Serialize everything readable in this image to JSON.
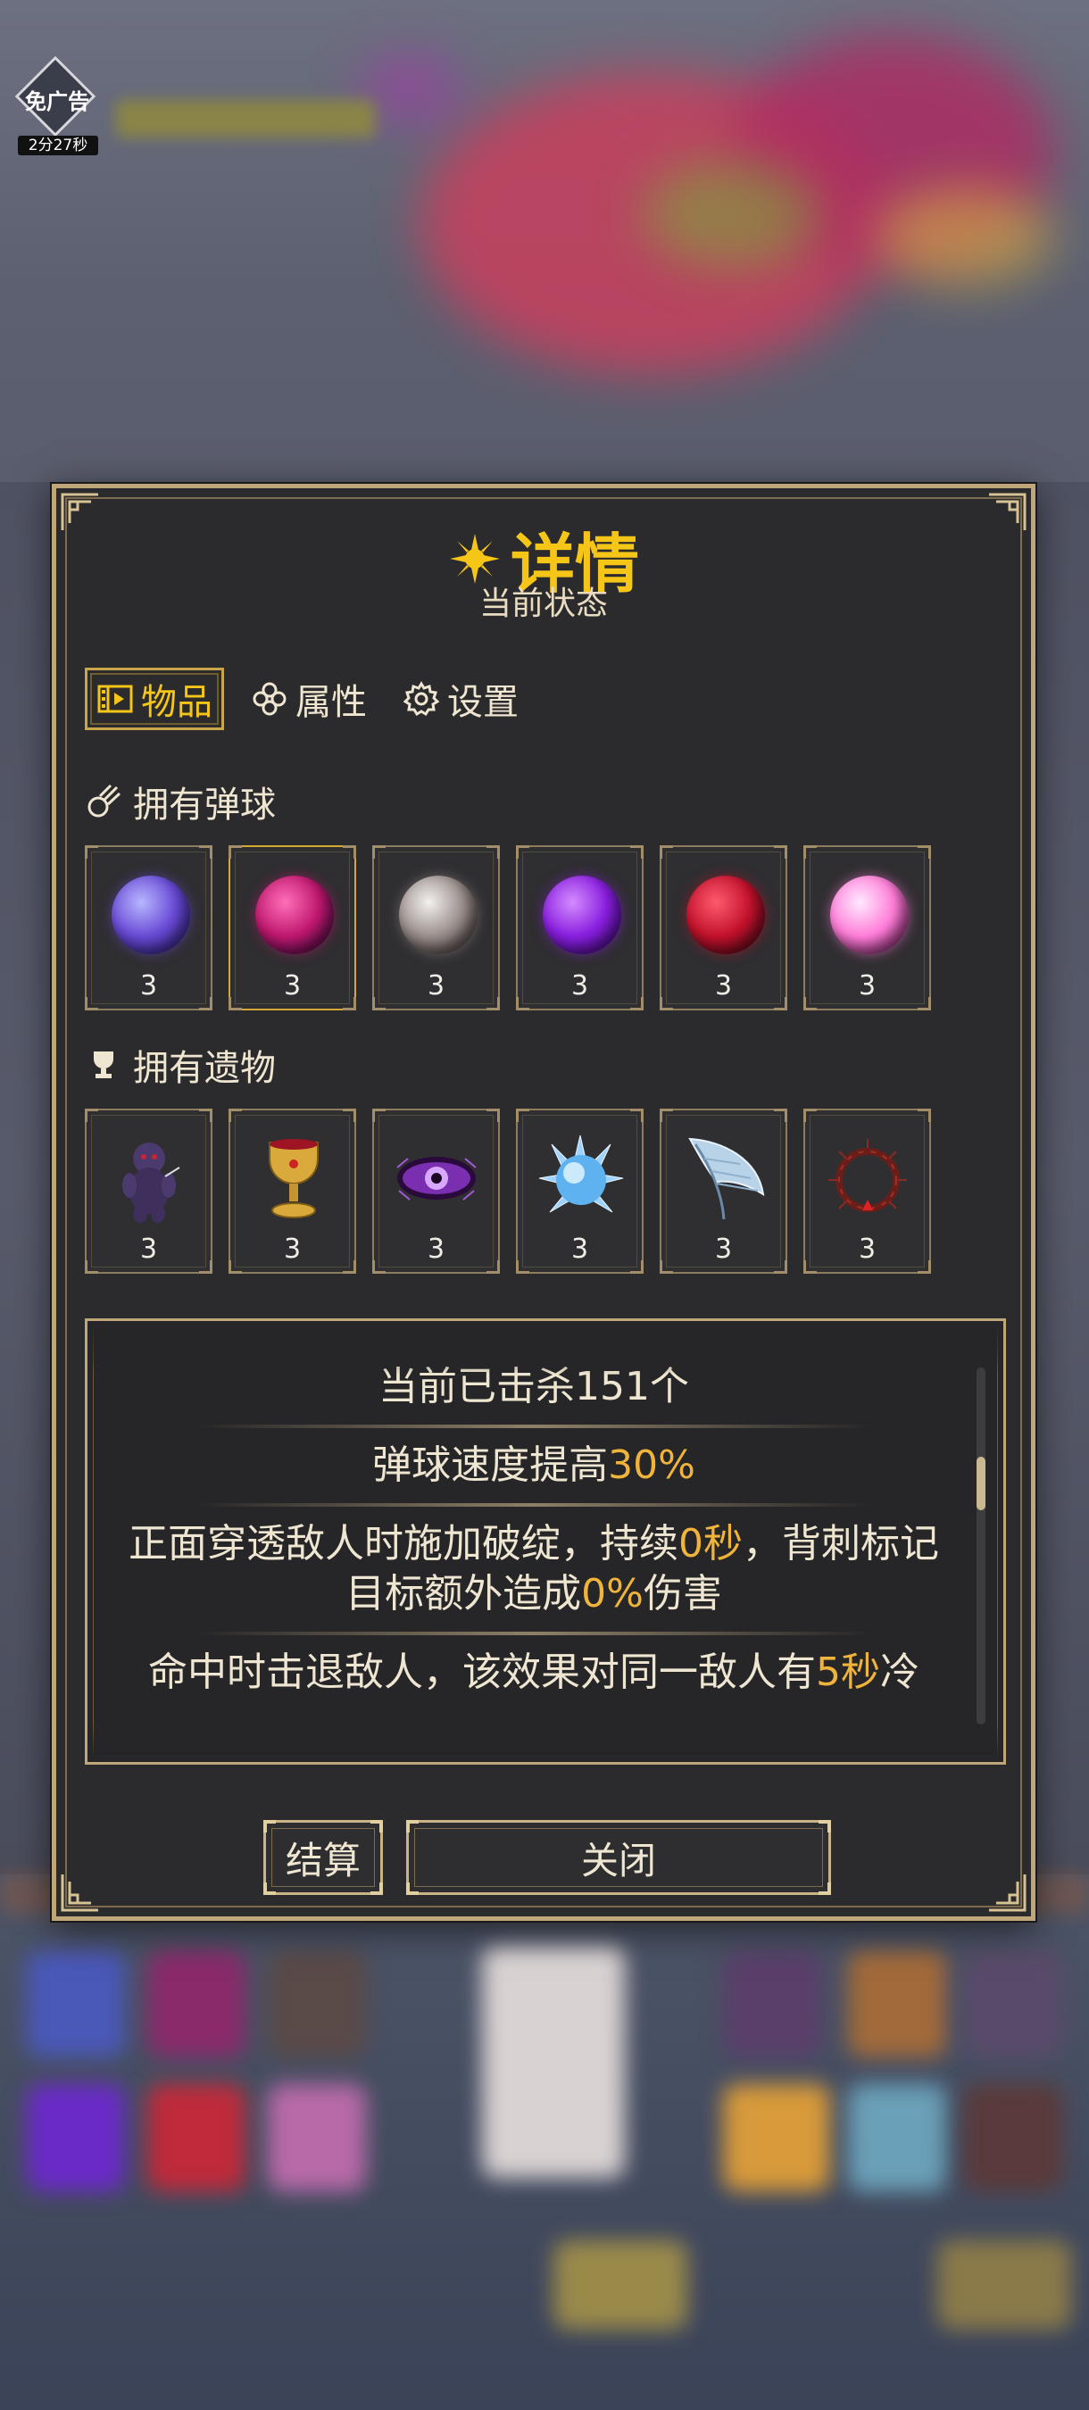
{
  "ad": {
    "label": "免广告",
    "timer": "2分27秒"
  },
  "panel": {
    "title": "详情",
    "subtitle": "当前状态"
  },
  "tabs": [
    {
      "label": "物品",
      "icon": "film-icon",
      "active": true
    },
    {
      "label": "属性",
      "icon": "clover-icon",
      "active": false
    },
    {
      "label": "设置",
      "icon": "gear-icon",
      "active": false
    }
  ],
  "balls": {
    "header": "拥有弹球",
    "items": [
      {
        "name": "blue-purple-orb",
        "count": "3",
        "colors": [
          "#b7b6ff",
          "#6a4bd6",
          "#2c1a7a"
        ]
      },
      {
        "name": "magenta-orb",
        "count": "3",
        "colors": [
          "#ff6fb8",
          "#c0186e",
          "#3b0a48"
        ]
      },
      {
        "name": "silver-orb",
        "count": "3",
        "colors": [
          "#f3f0ee",
          "#9a8f8c",
          "#3a2f30"
        ]
      },
      {
        "name": "violet-orb",
        "count": "3",
        "colors": [
          "#d48cff",
          "#8a1fe0",
          "#3a0875"
        ]
      },
      {
        "name": "crimson-orb",
        "count": "3",
        "colors": [
          "#ff5a6e",
          "#c3122c",
          "#4a0616"
        ]
      },
      {
        "name": "plasma-orb",
        "count": "3",
        "colors": [
          "#ffe9ff",
          "#ff7ed9",
          "#6a1155"
        ]
      }
    ]
  },
  "relics": {
    "header": "拥有遗物",
    "items": [
      {
        "name": "voodoo-doll",
        "count": "3"
      },
      {
        "name": "golden-chalice",
        "count": "3"
      },
      {
        "name": "purple-eye",
        "count": "3"
      },
      {
        "name": "ice-orb",
        "count": "3"
      },
      {
        "name": "feather-wing",
        "count": "3"
      },
      {
        "name": "thorn-crown",
        "count": "3"
      }
    ]
  },
  "description": {
    "kill_prefix": "当前已击杀",
    "kill_count": "151",
    "kill_suffix": "个",
    "speed_prefix": "弹球速度提高",
    "speed_value": "30%",
    "pierce_a": "正面穿透敌人时施加破绽，持续",
    "pierce_sec": "0秒",
    "pierce_b": "，背刺标记目标额外造成",
    "pierce_pct": "0%",
    "pierce_c": "伤害",
    "knock_a": "命中时击退敌人，该效果对同一敌人有",
    "knock_sec": "5秒",
    "knock_b": "冷"
  },
  "buttons": {
    "settle": "结算",
    "close": "关闭"
  },
  "colors": {
    "accent": "#f5c518",
    "highlight": "#f0b43a",
    "frame": "#bfa77a"
  }
}
